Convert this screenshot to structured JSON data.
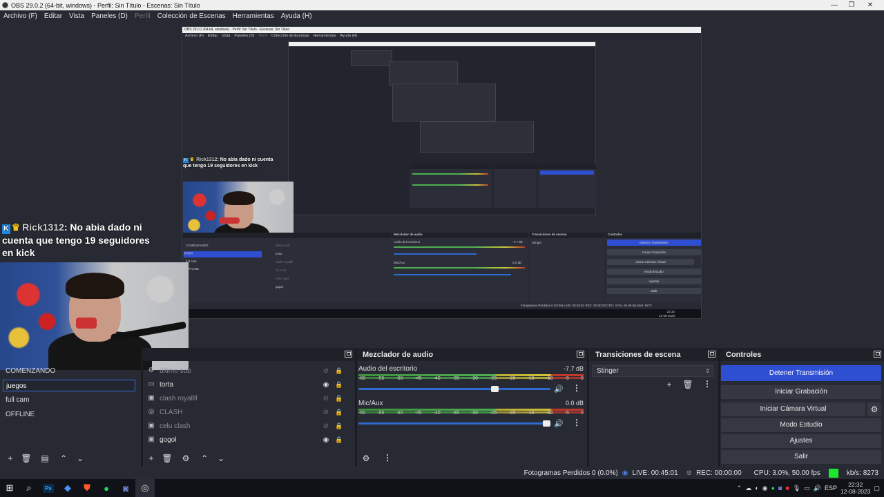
{
  "window": {
    "title": "OBS 29.0.2 (64-bit, windows) - Perfil: Sin Título - Escenas: Sin Título",
    "minimize": "—",
    "maximize": "❐",
    "close": "✕"
  },
  "menu": [
    {
      "label": "Archivo (F)",
      "enabled": true
    },
    {
      "label": "Editar",
      "enabled": true
    },
    {
      "label": "Vista",
      "enabled": true
    },
    {
      "label": "Paneles (D)",
      "enabled": true
    },
    {
      "label": "Perfil",
      "enabled": false
    },
    {
      "label": "Colección de Escenas",
      "enabled": true
    },
    {
      "label": "Herramientas",
      "enabled": true
    },
    {
      "label": "Ayuda (H)",
      "enabled": true
    }
  ],
  "chat": {
    "username": "Rick1312",
    "message": ": No abia dado ni cuenta que tengo 19 seguidores en kick"
  },
  "preview": {
    "title": "OBS 29.0.2 (64-bit, windows) - Perfil: Sin Título - Escenas: Sin Título",
    "menu": [
      "Archivo (F)",
      "Editar",
      "Vista",
      "Paneles (D)",
      "Perfil",
      "Colección de Escenas",
      "Herramientas",
      "Ayuda (H)"
    ],
    "mixer_title": "Mezclador de audio",
    "transitions_title": "Transiciones de escena",
    "controls_title": "Controles",
    "audio1": "Audio del escritorio",
    "audio1_db": "-7.7 dB",
    "audio2": "Mic/Aux",
    "audio2_db": "0.0 dB",
    "transition": "Stinger",
    "controls": [
      "Detener Transmisión",
      "Iniciar Grabación",
      "Iniciar Cámara Virtual",
      "Modo Estudio",
      "Ajustes",
      "Salir"
    ],
    "scenes": [
      "COMENZANDO",
      "juegos",
      "full cam",
      "OFFLINE"
    ],
    "sources": [
      "último sub",
      "torta",
      "clash royallll",
      "CLASH",
      "celu clash",
      "gogol"
    ],
    "status": "Fotogramas Perdidos 0 (0.0%)   LIVE: 00:45:01   REC: 00:00:00   CPU: 3.0%, 50.00 fps   kb/s: 8273",
    "clock_time": "22:32",
    "clock_date": "12-08-2023"
  },
  "docks": {
    "mixer_title": "Mezclador de audio",
    "transitions_title": "Transiciones de escena",
    "controls_title": "Controles"
  },
  "scenes": [
    {
      "name": "COMENZANDO",
      "selected": false
    },
    {
      "name": "juegos",
      "selected": true
    },
    {
      "name": "full cam",
      "selected": false
    },
    {
      "name": "OFFLINE",
      "selected": false
    }
  ],
  "sources": [
    {
      "name": "último sub",
      "icon": "gear-icon",
      "visible": false
    },
    {
      "name": "torta",
      "icon": "monitor-icon",
      "visible": true
    },
    {
      "name": "clash royallll",
      "icon": "window-icon",
      "visible": false
    },
    {
      "name": "CLASH",
      "icon": "gamepad-icon",
      "visible": false
    },
    {
      "name": "celu clash",
      "icon": "window-icon",
      "visible": false
    },
    {
      "name": "gogol",
      "icon": "window-icon",
      "visible": true
    }
  ],
  "mixer": {
    "tracks": [
      {
        "name": "Audio del escritorio",
        "db": "-7.7 dB",
        "volume": 0.72
      },
      {
        "name": "Mic/Aux",
        "db": "0.0 dB",
        "volume": 1.0
      }
    ],
    "ticks": [
      "-60",
      "-55",
      "-50",
      "-45",
      "-40",
      "-35",
      "-30",
      "-25",
      "-20",
      "-15",
      "-10",
      "-5",
      "0"
    ]
  },
  "transition": {
    "selected": "Stinger"
  },
  "controls": {
    "stop_stream": "Detener Transmisión",
    "start_recording": "Iniciar Grabación",
    "start_virtual_cam": "Iniciar Cámara Virtual",
    "studio_mode": "Modo Estudio",
    "settings": "Ajustes",
    "exit": "Salir"
  },
  "status": {
    "dropped_frames": "Fotogramas Perdidos 0 (0.0%)",
    "live": "LIVE: 00:45:01",
    "rec": "REC: 00:00:00",
    "cpu": "CPU: 3.0%, 50.00 fps",
    "bitrate": "kb/s: 8273",
    "bitrate_color": "#1ee62e"
  },
  "taskbar": {
    "apps": [
      "windows-start-icon",
      "search-icon",
      "photoshop-icon",
      "ai-app-icon",
      "brave-browser-icon",
      "spotify-icon",
      "discord-icon",
      "obs-icon"
    ],
    "photoshop_label": "Ps",
    "language": "ESP",
    "time": "22:32",
    "date": "12-08-2023"
  }
}
